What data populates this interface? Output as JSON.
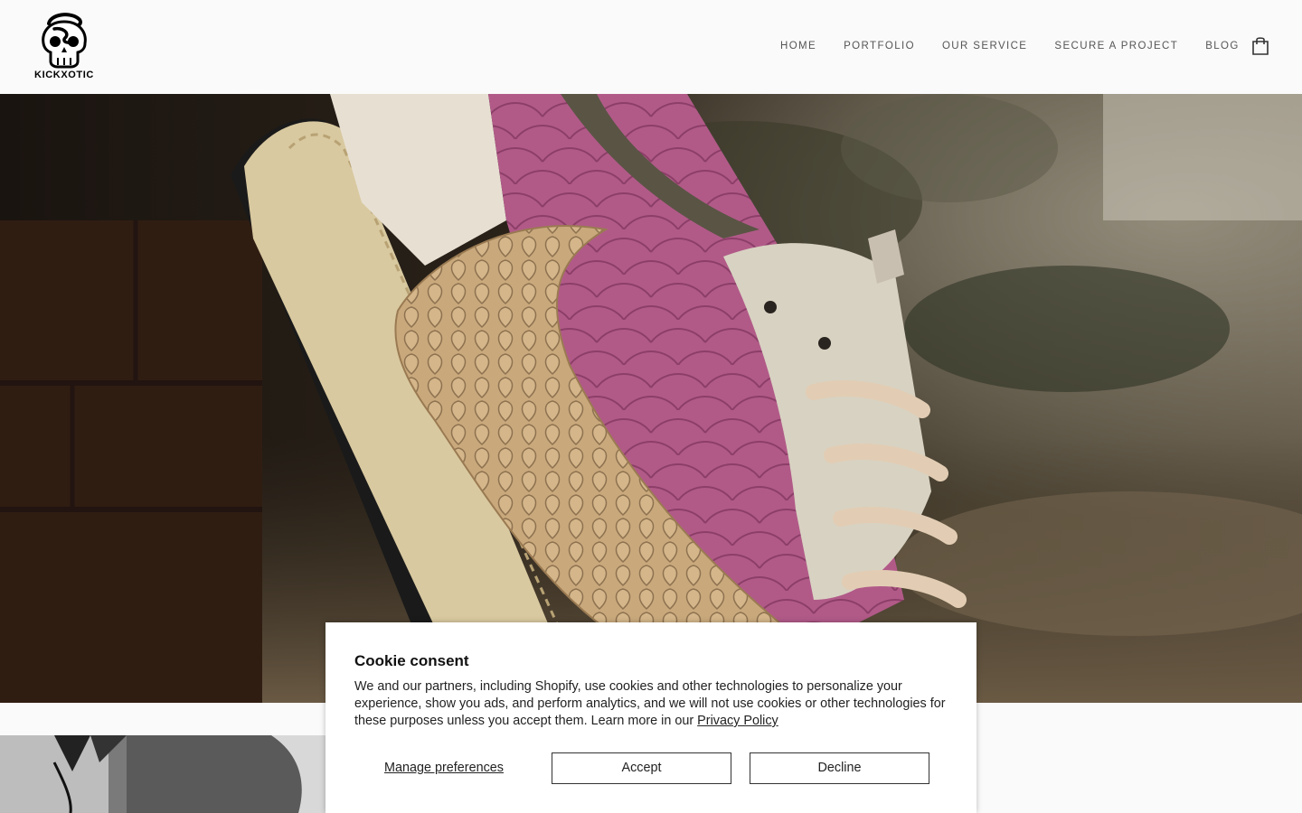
{
  "brand": {
    "logo_text": "KICKXOTIC"
  },
  "nav": {
    "items": [
      {
        "label": "HOME"
      },
      {
        "label": "PORTFOLIO"
      },
      {
        "label": "OUR SERVICE"
      },
      {
        "label": "SECURE A PROJECT"
      },
      {
        "label": "BLOG"
      }
    ],
    "cart_icon": "shopping-bag-icon"
  },
  "hero": {
    "image_alt": "Custom sneaker with pink python and tan snakeskin swoosh",
    "colors": {
      "pink": "#b55a86",
      "tan": "#c8a878",
      "cream": "#e8ddc8",
      "background": "#3a2e22"
    }
  },
  "cookie": {
    "title": "Cookie consent",
    "body": "We and our partners, including Shopify, use cookies and other technologies to personalize your experience, show you ads, and perform analytics, and we will not use cookies or other technologies for these purposes unless you accept them. Learn more in our ",
    "privacy_link": "Privacy Policy",
    "manage_label": "Manage preferences",
    "accept_label": "Accept",
    "decline_label": "Decline"
  }
}
